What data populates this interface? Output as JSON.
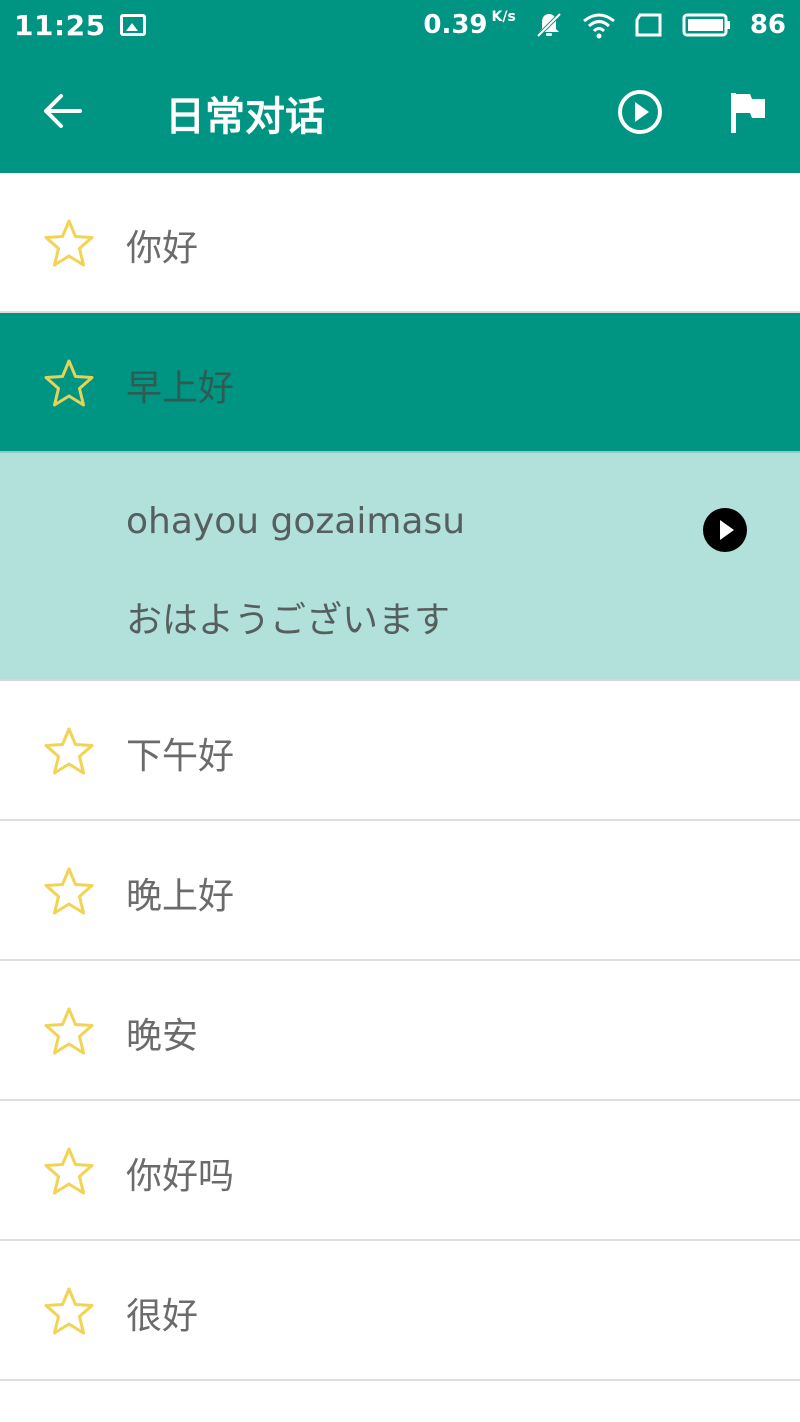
{
  "status_bar": {
    "time": "11:25",
    "speed": "0.39",
    "speed_unit": "K/s",
    "battery": "86"
  },
  "app_bar": {
    "title": "日常对话"
  },
  "phrases": [
    {
      "label": "你好",
      "active": false
    },
    {
      "label": "早上好",
      "active": true
    },
    {
      "label": "下午好",
      "active": false
    },
    {
      "label": "晚上好",
      "active": false
    },
    {
      "label": "晚安",
      "active": false
    },
    {
      "label": "你好吗",
      "active": false
    },
    {
      "label": "很好",
      "active": false
    }
  ],
  "detail": {
    "romaji": "ohayou gozaimasu",
    "kana": "おはようございます"
  },
  "colors": {
    "primary": "#009482",
    "detail_bg": "#b2e0da",
    "star": "#f2d353"
  }
}
